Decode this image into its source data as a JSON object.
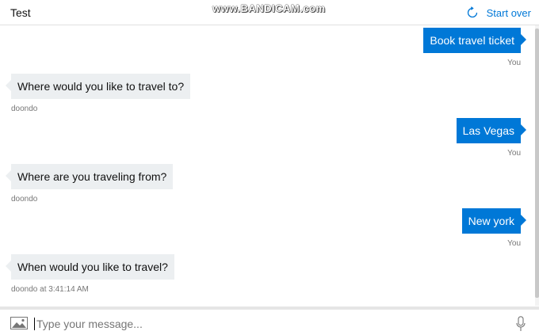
{
  "header": {
    "title": "Test",
    "watermark": "www.BANDICAM.com",
    "start_over_label": "Start over",
    "start_over_icon": "refresh-icon",
    "accent_color": "#0078d7"
  },
  "messages": [
    {
      "from": "user",
      "text": "Book travel ticket",
      "meta": "You"
    },
    {
      "from": "bot",
      "text": "Where would you like to travel to?",
      "meta": "doondo"
    },
    {
      "from": "user",
      "text": "Las Vegas",
      "meta": "You"
    },
    {
      "from": "bot",
      "text": "Where are you traveling from?",
      "meta": "doondo"
    },
    {
      "from": "user",
      "text": "New york",
      "meta": "You"
    },
    {
      "from": "bot",
      "text": "When would you like to travel?",
      "meta": "doondo at 3:41:14 AM"
    }
  ],
  "colors": {
    "user_bubble": "#0078d7",
    "bot_bubble": "#eceff1",
    "meta_text": "#767676"
  },
  "composer": {
    "placeholder": "Type your message...",
    "value": "",
    "upload_icon": "image-upload-icon",
    "mic_icon": "microphone-icon"
  }
}
